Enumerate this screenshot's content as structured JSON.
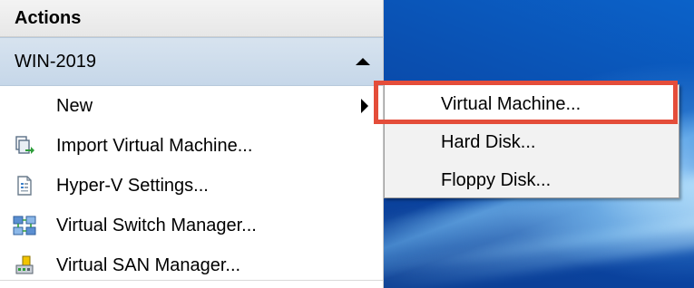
{
  "actions_pane": {
    "header": "Actions",
    "group": {
      "title": "WIN-2019",
      "collapse_icon": "triangle-up-icon"
    },
    "items": [
      {
        "label": "New",
        "icon": null,
        "has_submenu": true
      },
      {
        "label": "Import Virtual Machine...",
        "icon": "import-vm-icon"
      },
      {
        "label": "Hyper-V Settings...",
        "icon": "settings-document-icon"
      },
      {
        "label": "Virtual Switch Manager...",
        "icon": "network-switch-icon"
      },
      {
        "label": "Virtual SAN Manager...",
        "icon": "san-manager-icon"
      }
    ]
  },
  "submenu": {
    "items": [
      {
        "label": "Virtual Machine...",
        "hovered": true
      },
      {
        "label": "Hard Disk..."
      },
      {
        "label": "Floppy Disk..."
      }
    ]
  },
  "colors": {
    "highlight": "#e44d3a",
    "group_header": "#cbdaea",
    "desktop": "#0a4fb0"
  }
}
